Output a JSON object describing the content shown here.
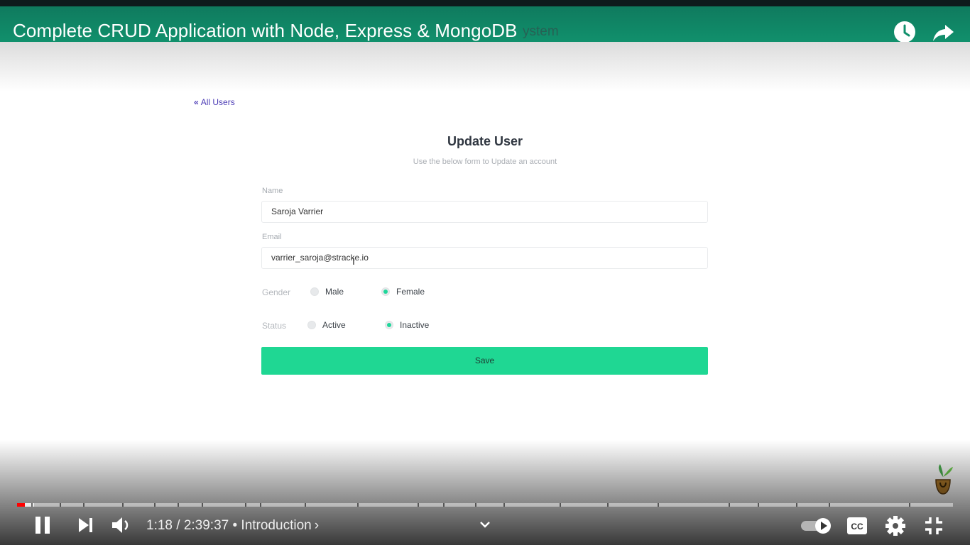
{
  "video": {
    "title": "Complete CRUD Application with Node, Express & MongoDB",
    "behind_text": "ystem"
  },
  "page": {
    "back_link": "All Users",
    "back_icon": "«",
    "form_title": "Update User",
    "form_subtitle": "Use the below form to Update an account",
    "name_label": "Name",
    "name_value": "Saroja Varrier",
    "email_label": "Email",
    "email_value": "varrier_saroja@stracke.io",
    "gender_label": "Gender",
    "gender_options": [
      "Male",
      "Female"
    ],
    "gender_selected": "Female",
    "status_label": "Status",
    "status_options": [
      "Active",
      "Inactive"
    ],
    "status_selected": "Inactive",
    "save_label": "Save"
  },
  "player": {
    "current_time": "1:18",
    "duration": "2:39:37",
    "chapter": "Introduction",
    "time_display": "1:18 / 2:39:37 • Introduction",
    "chapter_chevron": "›",
    "played_fraction": 0.008,
    "buffered_fraction": 0.018,
    "icons": [
      "pause-icon",
      "next-icon",
      "volume-icon",
      "chevron-down-icon",
      "autoplay-toggle",
      "captions-icon",
      "settings-icon",
      "exit-fullscreen-icon",
      "watch-later-icon",
      "share-icon"
    ],
    "accent_color": "#ff0000"
  },
  "colors": {
    "title_bar": "#11906c",
    "save_button": "#1fd793",
    "link": "#4b3bb5",
    "radio_selected": "#1fd79a"
  }
}
